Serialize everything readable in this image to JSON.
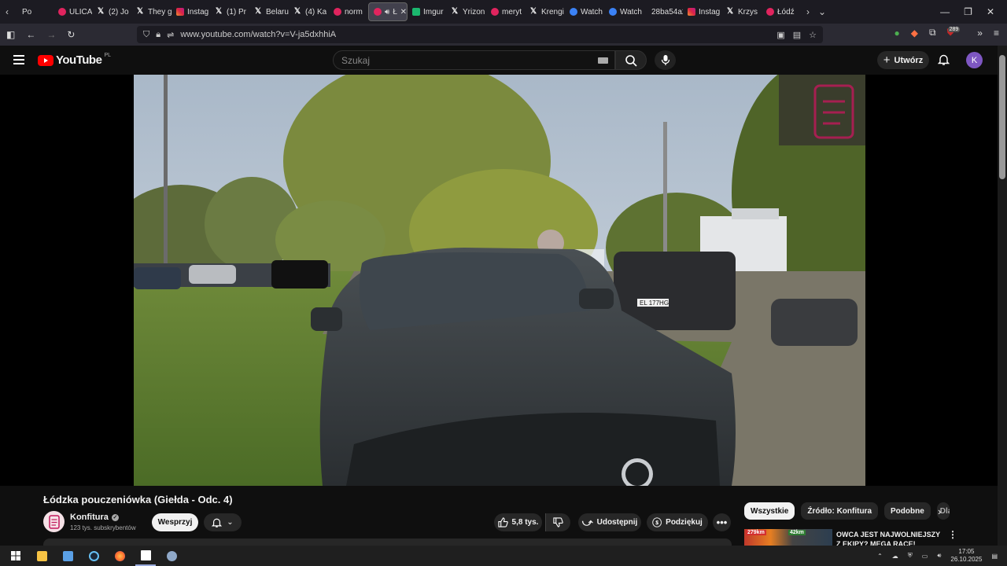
{
  "browser": {
    "tabs": [
      {
        "label": "Po",
        "fav": "none"
      },
      {
        "label": "ULICA",
        "fav": "yt"
      },
      {
        "label": "(2) Jo",
        "fav": "x"
      },
      {
        "label": "They g",
        "fav": "x"
      },
      {
        "label": "Instag",
        "fav": "ig"
      },
      {
        "label": "(1) Pr",
        "fav": "x"
      },
      {
        "label": "Belaru",
        "fav": "x"
      },
      {
        "label": "(4) Ka",
        "fav": "x"
      },
      {
        "label": "norm",
        "fav": "yt"
      },
      {
        "label": "Łód",
        "fav": "yt",
        "active": true
      },
      {
        "label": "Imgur",
        "fav": "im"
      },
      {
        "label": "Yrizon",
        "fav": "x"
      },
      {
        "label": "meryt",
        "fav": "yt"
      },
      {
        "label": "Krengi",
        "fav": "x"
      },
      {
        "label": "Watch",
        "fav": "wt"
      },
      {
        "label": "Watch",
        "fav": "wt"
      },
      {
        "label": "28ba54a2",
        "fav": "none"
      },
      {
        "label": "Instag",
        "fav": "ig"
      },
      {
        "label": "Krzys",
        "fav": "x"
      },
      {
        "label": "Łódź",
        "fav": "yt"
      }
    ],
    "url": "www.youtube.com/watch?v=V-ja5dxhhiA",
    "extension_badge": "289"
  },
  "youtube": {
    "logo_text": "YouTube",
    "country_code": "PL",
    "search_placeholder": "Szukaj",
    "create_label": "Utwórz",
    "avatar_letter": "K"
  },
  "video": {
    "title": "Łódzka pouczeniówka (Giełda - Odc. 4)",
    "channel_name": "Konfitura",
    "subscribers": "123 tys. subskrybentów",
    "support_label": "Wesprzyj",
    "likes": "5,8 tys.",
    "share_label": "Udostępnij",
    "thanks_label": "Podziękuj",
    "more_label": "•••",
    "plate": "EL 177HG"
  },
  "sidebar": {
    "chips": [
      "Wszystkie",
      "Źródło: Konfitura",
      "Podobne",
      "Dla"
    ],
    "rec_title": "OWCA JEST NAJWOLNIEJSZY Z EKIPY? MEGA RACE!",
    "rec_thumb_badge_1": "279km",
    "rec_thumb_badge_2": "42km"
  },
  "taskbar": {
    "time": "17:05",
    "date": "26.10.2025"
  }
}
